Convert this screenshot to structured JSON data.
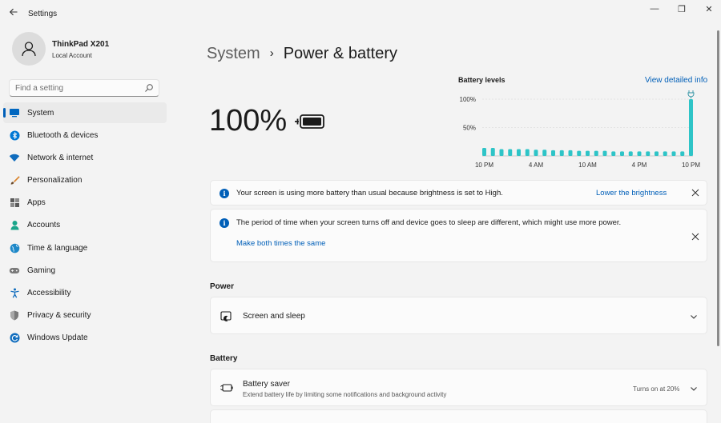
{
  "window": {
    "title": "Settings",
    "minimize_glyph": "—",
    "maximize_glyph": "❐",
    "close_glyph": "✕"
  },
  "profile": {
    "name": "ThinkPad X201",
    "account": "Local Account"
  },
  "search": {
    "placeholder": "Find a setting"
  },
  "nav": [
    {
      "label": "System",
      "icon": "system-icon",
      "color": "#0067c0",
      "active": true
    },
    {
      "label": "Bluetooth & devices",
      "icon": "bluetooth-icon",
      "color": "#0078d4"
    },
    {
      "label": "Network & internet",
      "icon": "wifi-icon",
      "color": "#0f6cbd"
    },
    {
      "label": "Personalization",
      "icon": "brush-icon",
      "color": "#d9822b"
    },
    {
      "label": "Apps",
      "icon": "apps-icon",
      "color": "#5a5a5a"
    },
    {
      "label": "Accounts",
      "icon": "accounts-icon",
      "color": "#19a58a"
    },
    {
      "label": "Time & language",
      "icon": "globe-icon",
      "color": "#1e88c8"
    },
    {
      "label": "Gaming",
      "icon": "gamepad-icon",
      "color": "#7a7a7a"
    },
    {
      "label": "Accessibility",
      "icon": "accessibility-icon",
      "color": "#0f6cbd"
    },
    {
      "label": "Privacy & security",
      "icon": "shield-icon",
      "color": "#7a7a7a"
    },
    {
      "label": "Windows Update",
      "icon": "update-icon",
      "color": "#0f6cbd"
    }
  ],
  "breadcrumb": {
    "parent": "System",
    "separator": "›",
    "current": "Power & battery"
  },
  "battery": {
    "percent_label": "100%",
    "level": 1.0
  },
  "chart_data": {
    "type": "bar",
    "title": "Battery levels",
    "link": "View detailed info",
    "y_tick_labels": [
      "100%",
      "50%"
    ],
    "x_tick_labels": [
      "10 PM",
      "4 AM",
      "10 AM",
      "4 PM",
      "10 PM"
    ],
    "ylim": [
      0,
      100
    ],
    "values": [
      14,
      14,
      12,
      12,
      12,
      12,
      11,
      11,
      10,
      10,
      10,
      9,
      9,
      9,
      9,
      8,
      8,
      8,
      8,
      8,
      8,
      8,
      8,
      8,
      100
    ],
    "bar_color": "#2ec4c7",
    "grid": true,
    "charging_marker": "plug-icon"
  },
  "notices": [
    {
      "text": "Your screen is using more battery than usual because brightness is set to High.",
      "action": "Lower the brightness"
    },
    {
      "text": "The period of time when your screen turns off and device goes to sleep are different, which might use more power.",
      "action": "Make both times the same"
    }
  ],
  "sections": {
    "power": {
      "label": "Power",
      "row_title": "Screen and sleep"
    },
    "battery": {
      "label": "Battery",
      "row_title": "Battery saver",
      "row_subtitle": "Extend battery life by limiting some notifications and background activity",
      "row_value": "Turns on at 20%"
    }
  },
  "colors": {
    "accent": "#005fb8",
    "background": "#f3f3f3",
    "card": "#fbfbfb"
  }
}
